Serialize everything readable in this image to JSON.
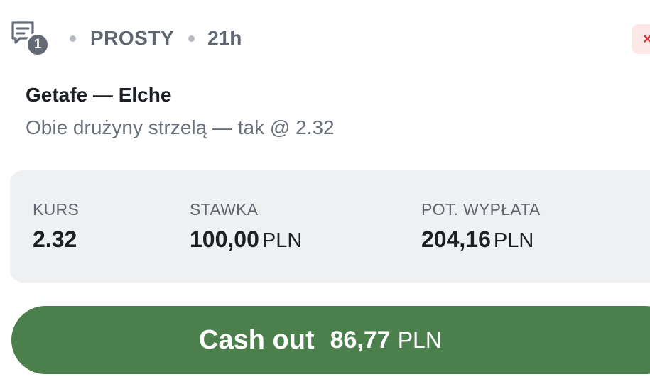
{
  "header": {
    "bet_count": "1",
    "bet_type": "PROSTY",
    "time_ago": "21h",
    "close_icon": "×"
  },
  "bet": {
    "match": "Getafe — Elche",
    "selection": "Obie drużyny strzelą — tak @ 2.32"
  },
  "stats": {
    "odds": {
      "label": "KURS",
      "value": "2.32"
    },
    "stake": {
      "label": "STAWKA",
      "value": "100,00",
      "currency": "PLN"
    },
    "payout": {
      "label": "POT. WYPŁATA",
      "value": "204,16",
      "currency": "PLN"
    }
  },
  "cashout": {
    "label": "Cash out",
    "amount": "86,77",
    "currency": "PLN"
  },
  "colors": {
    "cashout_button": "#4b7f4b",
    "panel_bg": "#eff0f2",
    "badge": "#636a76",
    "close_bg": "#fde8e8",
    "close_fg": "#d9363e"
  },
  "icons": {
    "bet_slip": "bet-slip-icon",
    "close": "close-icon"
  }
}
